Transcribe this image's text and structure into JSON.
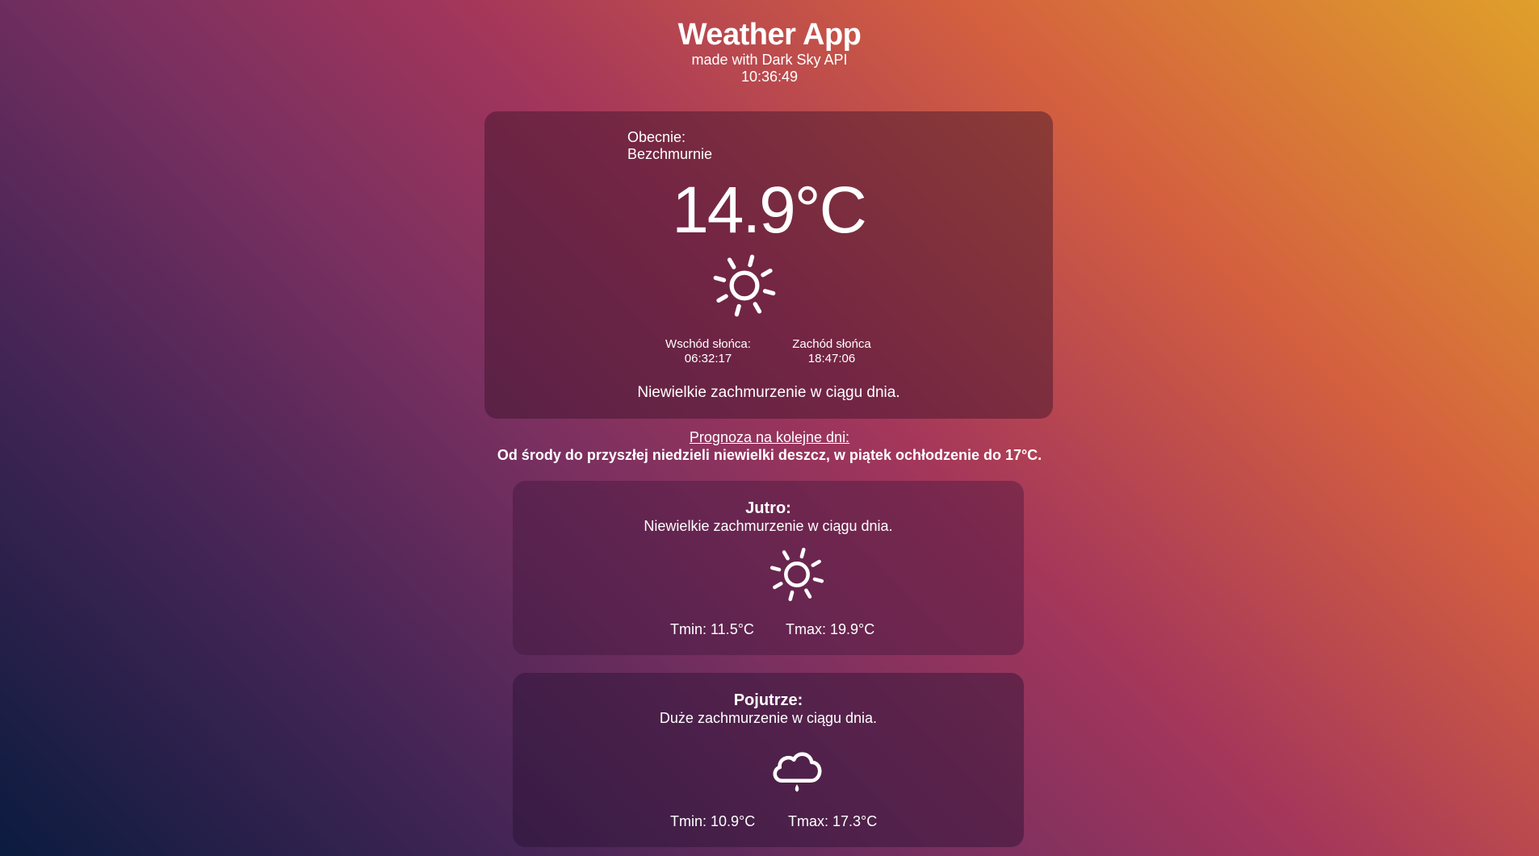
{
  "header": {
    "title": "Weather App",
    "subtitle": "made with Dark Sky API",
    "clock": "10:36:49"
  },
  "current": {
    "label": "Obecnie:",
    "condition": "Bezchmurnie",
    "temperature": "14.9°C",
    "icon": "sun-icon",
    "sunrise_label": "Wschód słońca:",
    "sunrise_time": "06:32:17",
    "sunset_label": "Zachód słońca",
    "sunset_time": "18:47:06",
    "summary": "Niewielkie zachmurzenie w ciągu dnia."
  },
  "forecast": {
    "title": "Prognoza na kolejne dni:",
    "summary": "Od środy do przyszłej niedzieli niewielki deszcz, w piątek ochłodzenie do 17°C.",
    "days": [
      {
        "name": "Jutro:",
        "summary": "Niewielkie zachmurzenie w ciągu dnia.",
        "icon": "sun-icon",
        "tmin": "Tmin: 11.5°C",
        "tmax": "Tmax: 19.9°C"
      },
      {
        "name": "Pojutrze:",
        "summary": "Duże zachmurzenie w ciągu dnia.",
        "icon": "cloud-rain-icon",
        "tmin": "Tmin: 10.9°C",
        "tmax": "Tmax: 17.3°C"
      }
    ]
  },
  "colors": {
    "text": "#ffffff",
    "gradient_top_right": "#dfa02a",
    "gradient_mid": "#a4365b",
    "gradient_bottom_left": "#0b1b3f"
  }
}
